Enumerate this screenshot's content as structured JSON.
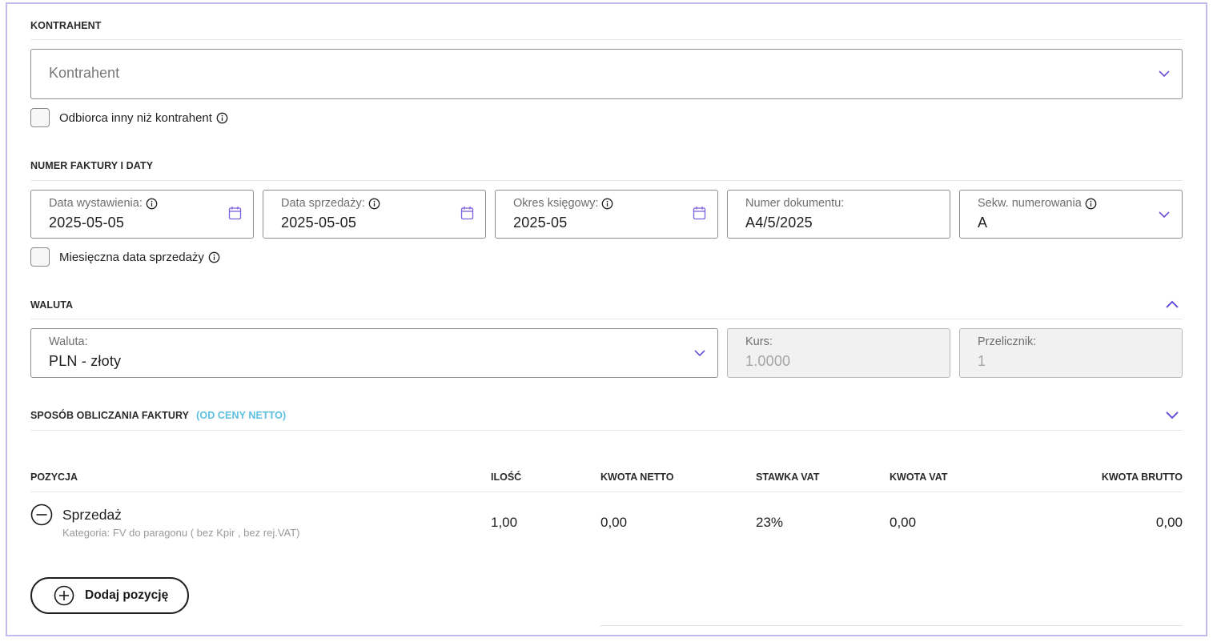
{
  "kontrahent": {
    "section_title": "KONTRAHENT",
    "select_placeholder": "Kontrahent",
    "checkbox_label": "Odbiorca inny niż kontrahent"
  },
  "numer": {
    "section_title": "NUMER FAKTURY I DATY",
    "fields": [
      {
        "label": "Data wystawienia:",
        "value": "2025-05-05"
      },
      {
        "label": "Data sprzedaży:",
        "value": "2025-05-05"
      },
      {
        "label": "Okres księgowy:",
        "value": "2025-05"
      },
      {
        "label": "Numer dokumentu:",
        "value": "A4/5/2025"
      },
      {
        "label": "Sekw. numerowania",
        "value": "A"
      }
    ],
    "checkbox_label": "Miesięczna data sprzedaży"
  },
  "waluta": {
    "section_title": "WALUTA",
    "currency_label": "Waluta:",
    "currency_value": "PLN - złoty",
    "kurs_label": "Kurs:",
    "kurs_value": "1.0000",
    "przelicznik_label": "Przelicznik:",
    "przelicznik_value": "1"
  },
  "sposob": {
    "section_title": "SPOSÓB OBLICZANIA FAKTURY",
    "subtitle": "(OD CENY NETTO)"
  },
  "table": {
    "headers": {
      "pozycja": "POZYCJA",
      "ilosc": "ILOŚĆ",
      "netto": "KWOTA NETTO",
      "stawka": "STAWKA VAT",
      "vat": "KWOTA VAT",
      "brutto": "KWOTA BRUTTO"
    },
    "rows": [
      {
        "name": "Sprzedaż",
        "category": "Kategoria: FV do paragonu ( bez Kpir , bez rej.VAT)",
        "ilosc": "1,00",
        "netto": "0,00",
        "stawka": "23%",
        "vat": "0,00",
        "brutto": "0,00"
      }
    ]
  },
  "add_button_label": "Dodaj pozycję",
  "colors": {
    "frame": "#c4b8ec",
    "accent": "#6a4fd6",
    "subtitle": "#5bbfe0"
  }
}
